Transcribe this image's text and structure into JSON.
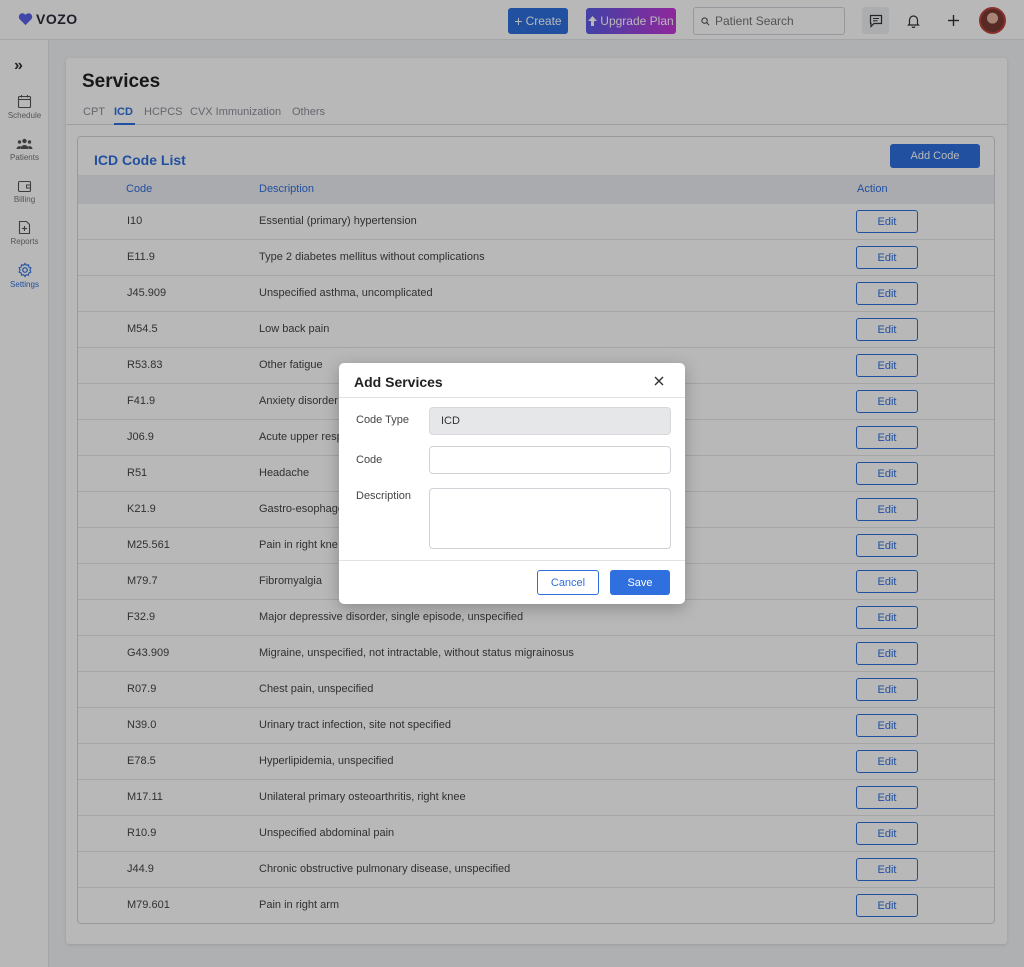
{
  "app": {
    "logo_text": "VOZO"
  },
  "topbar": {
    "create_label": "Create",
    "upgrade_label": "Upgrade Plan",
    "search_placeholder": "Patient Search"
  },
  "sidebar": {
    "items": [
      {
        "label": "Schedule"
      },
      {
        "label": "Patients"
      },
      {
        "label": "Billing"
      },
      {
        "label": "Reports"
      },
      {
        "label": "Settings",
        "active": true
      }
    ]
  },
  "page": {
    "title": "Services",
    "tabs": [
      "CPT",
      "ICD",
      "HCPCS",
      "CVX Immunization",
      "Others"
    ],
    "active_tab": "ICD"
  },
  "list": {
    "title": "ICD Code List",
    "add_label": "Add Code",
    "columns": [
      "Code",
      "Description",
      "Action"
    ],
    "edit_label": "Edit",
    "rows": [
      {
        "code": "I10",
        "description": "Essential (primary) hypertension"
      },
      {
        "code": "E11.9",
        "description": "Type 2 diabetes mellitus without complications"
      },
      {
        "code": "J45.909",
        "description": "Unspecified asthma, uncomplicated"
      },
      {
        "code": "M54.5",
        "description": "Low back pain"
      },
      {
        "code": "R53.83",
        "description": "Other fatigue"
      },
      {
        "code": "F41.9",
        "description": "Anxiety disorder"
      },
      {
        "code": "J06.9",
        "description": "Acute upper resp"
      },
      {
        "code": "R51",
        "description": "Headache"
      },
      {
        "code": "K21.9",
        "description": "Gastro-esophage"
      },
      {
        "code": "M25.561",
        "description": "Pain in right kne"
      },
      {
        "code": "M79.7",
        "description": "Fibromyalgia"
      },
      {
        "code": "F32.9",
        "description": "Major depressive disorder, single episode, unspecified"
      },
      {
        "code": "G43.909",
        "description": "Migraine, unspecified, not intractable, without status migrainosus"
      },
      {
        "code": "R07.9",
        "description": "Chest pain, unspecified"
      },
      {
        "code": "N39.0",
        "description": "Urinary tract infection, site not specified"
      },
      {
        "code": "E78.5",
        "description": "Hyperlipidemia, unspecified"
      },
      {
        "code": "M17.11",
        "description": "Unilateral primary osteoarthritis, right knee"
      },
      {
        "code": "R10.9",
        "description": "Unspecified abdominal pain"
      },
      {
        "code": "J44.9",
        "description": "Chronic obstructive pulmonary disease, unspecified"
      },
      {
        "code": "M79.601",
        "description": "Pain in right arm"
      }
    ]
  },
  "modal": {
    "title": "Add Services",
    "code_type_label": "Code Type",
    "code_type_value": "ICD",
    "code_label": "Code",
    "code_value": "",
    "description_label": "Description",
    "description_value": "",
    "cancel_label": "Cancel",
    "save_label": "Save"
  },
  "colors": {
    "accent": "#2f6fde",
    "upgrade_start": "#5b5ce6",
    "upgrade_end": "#c637d8"
  }
}
